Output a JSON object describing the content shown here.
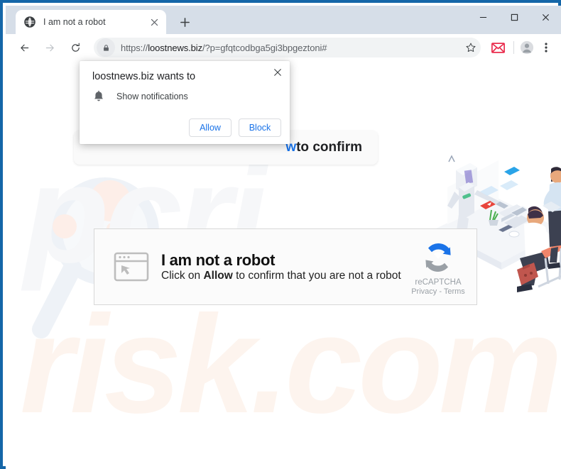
{
  "window": {
    "controls": {
      "minimize": "minimize-icon",
      "maximize": "maximize-icon",
      "close": "close-icon"
    }
  },
  "tabstrip": {
    "tab": {
      "favicon": "globe-icon",
      "title": "I am not a robot",
      "close": "close-icon"
    },
    "new_tab": "+"
  },
  "toolbar": {
    "back": "back-arrow-icon",
    "forward": "forward-arrow-icon",
    "reload": "reload-icon",
    "lock": "lock-icon",
    "url_scheme": "https://",
    "url_host": "loostnews.biz",
    "url_path": "/?p=gfqtcodbga5gi3bpgeztoni#",
    "url_full": "https://loostnews.biz/?p=gfqtcodbga5gi3bpgeztoni#",
    "bookmark": "star-icon",
    "extension": "envelope-icon",
    "profile": "avatar-icon",
    "menu": "three-dot-menu-icon"
  },
  "permission_popup": {
    "title": "loostnews.biz wants to",
    "bell_icon": "bell-icon",
    "permission_label": "Show notifications",
    "allow_label": "Allow",
    "block_label": "Block",
    "close": "close-icon"
  },
  "page": {
    "top_banner": {
      "highlight": "w",
      "text": " to confirm"
    },
    "card": {
      "icon": "browser-window-cursor-icon",
      "title": "I am not a robot",
      "subtitle_before": "Click on ",
      "subtitle_bold": "Allow",
      "subtitle_after": " to confirm that you are not a robot",
      "recaptcha_logo": "recaptcha-icon",
      "recaptcha_name": "reCAPTCHA",
      "recaptcha_terms": "Privacy - Terms"
    },
    "illustration": "office-robot-illustration",
    "watermark_top": "pcri",
    "watermark_bottom": "risk.com"
  },
  "colors": {
    "frame_blue": "#1466a8",
    "titlebar": "#d6dee8",
    "accent_link": "#1a73e8",
    "omnibox": "#f1f3f4",
    "watermark_gray": "#f6f7f9",
    "watermark_peach": "#fdf4ee",
    "extension_red": "#ea4335"
  }
}
